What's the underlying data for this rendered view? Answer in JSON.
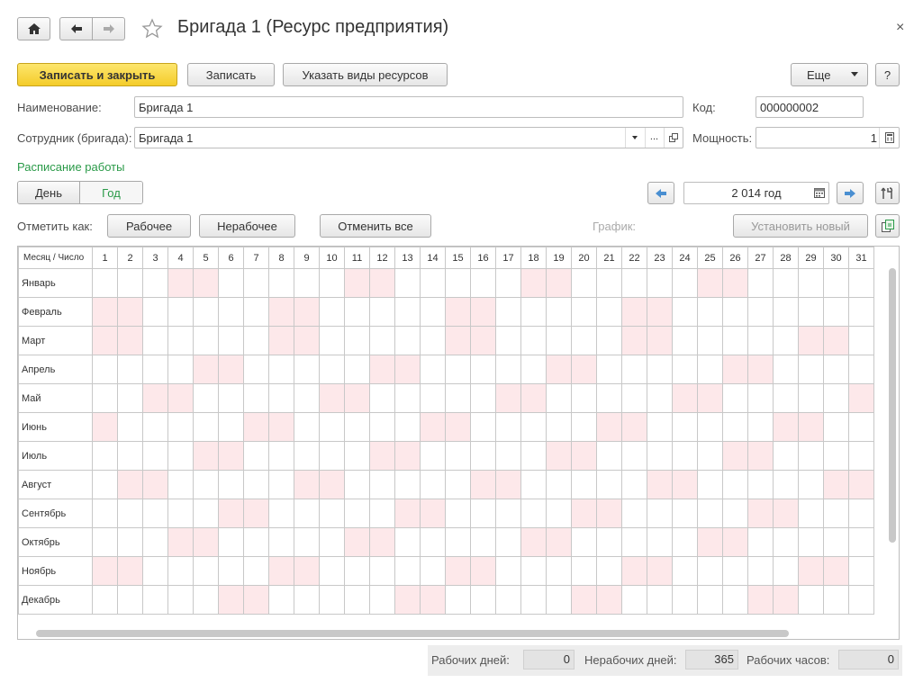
{
  "window": {
    "title": "Бригада 1 (Ресурс предприятия)",
    "close": "×"
  },
  "toolbar": {
    "save_close": "Записать и закрыть",
    "save": "Записать",
    "resource_types": "Указать виды ресурсов",
    "more": "Еще",
    "help": "?"
  },
  "form": {
    "name_label": "Наименование:",
    "name_value": "Бригада 1",
    "code_label": "Код:",
    "code_value": "000000002",
    "employee_label": "Сотрудник (бригада):",
    "employee_value": "Бригада 1",
    "power_label": "Мощность:",
    "power_value": "1",
    "dots": "..."
  },
  "schedule": {
    "section_title": "Расписание работы",
    "view_day": "День",
    "view_year": "Год",
    "year": "2 014 год",
    "mark_as_label": "Отметить как:",
    "working": "Рабочее",
    "nonworking": "Нерабочее",
    "cancel_all": "Отменить все",
    "schedule_label": "График:",
    "set_new": "Установить новый"
  },
  "table": {
    "header": "Месяц / Число",
    "days": [
      "1",
      "2",
      "3",
      "4",
      "5",
      "6",
      "7",
      "8",
      "9",
      "10",
      "11",
      "12",
      "13",
      "14",
      "15",
      "16",
      "17",
      "18",
      "19",
      "20",
      "21",
      "22",
      "23",
      "24",
      "25",
      "26",
      "27",
      "28",
      "29",
      "30",
      "31"
    ],
    "months": [
      {
        "name": "Январь",
        "off": [
          4,
          5,
          11,
          12,
          18,
          19,
          25,
          26
        ],
        "cols": 31
      },
      {
        "name": "Февраль",
        "off": [
          1,
          2,
          8,
          9,
          15,
          16,
          22,
          23
        ],
        "cols": 31
      },
      {
        "name": "Март",
        "off": [
          1,
          2,
          8,
          9,
          15,
          16,
          22,
          23,
          29,
          30
        ],
        "cols": 31
      },
      {
        "name": "Апрель",
        "off": [
          5,
          6,
          12,
          13,
          19,
          20,
          26,
          27
        ],
        "cols": 31
      },
      {
        "name": "Май",
        "off": [
          3,
          4,
          10,
          11,
          17,
          18,
          24,
          25,
          31
        ],
        "cols": 31
      },
      {
        "name": "Июнь",
        "off": [
          1,
          7,
          8,
          14,
          15,
          21,
          22,
          28,
          29
        ],
        "cols": 31
      },
      {
        "name": "Июль",
        "off": [
          5,
          6,
          12,
          13,
          19,
          20,
          26,
          27
        ],
        "cols": 31
      },
      {
        "name": "Август",
        "off": [
          2,
          3,
          9,
          10,
          16,
          17,
          23,
          24,
          30,
          31
        ],
        "cols": 31
      },
      {
        "name": "Сентябрь",
        "off": [
          6,
          7,
          13,
          14,
          20,
          21,
          27,
          28
        ],
        "cols": 31
      },
      {
        "name": "Октябрь",
        "off": [
          4,
          5,
          11,
          12,
          18,
          19,
          25,
          26
        ],
        "cols": 31
      },
      {
        "name": "Ноябрь",
        "off": [
          1,
          2,
          8,
          9,
          15,
          16,
          22,
          23,
          29,
          30
        ],
        "cols": 31
      },
      {
        "name": "Декабрь",
        "off": [
          6,
          7,
          13,
          14,
          20,
          21,
          27,
          28
        ],
        "cols": 31
      }
    ]
  },
  "totals": {
    "working_days_label": "Рабочих дней:",
    "working_days": "0",
    "nonworking_days_label": "Нерабочих дней:",
    "nonworking_days": "365",
    "working_hours_label": "Рабочих часов:",
    "working_hours": "0"
  },
  "colors": {
    "accent_green": "#2a9a48",
    "weekend": "#fde8ea",
    "primary_button": "#f4cc2a"
  }
}
